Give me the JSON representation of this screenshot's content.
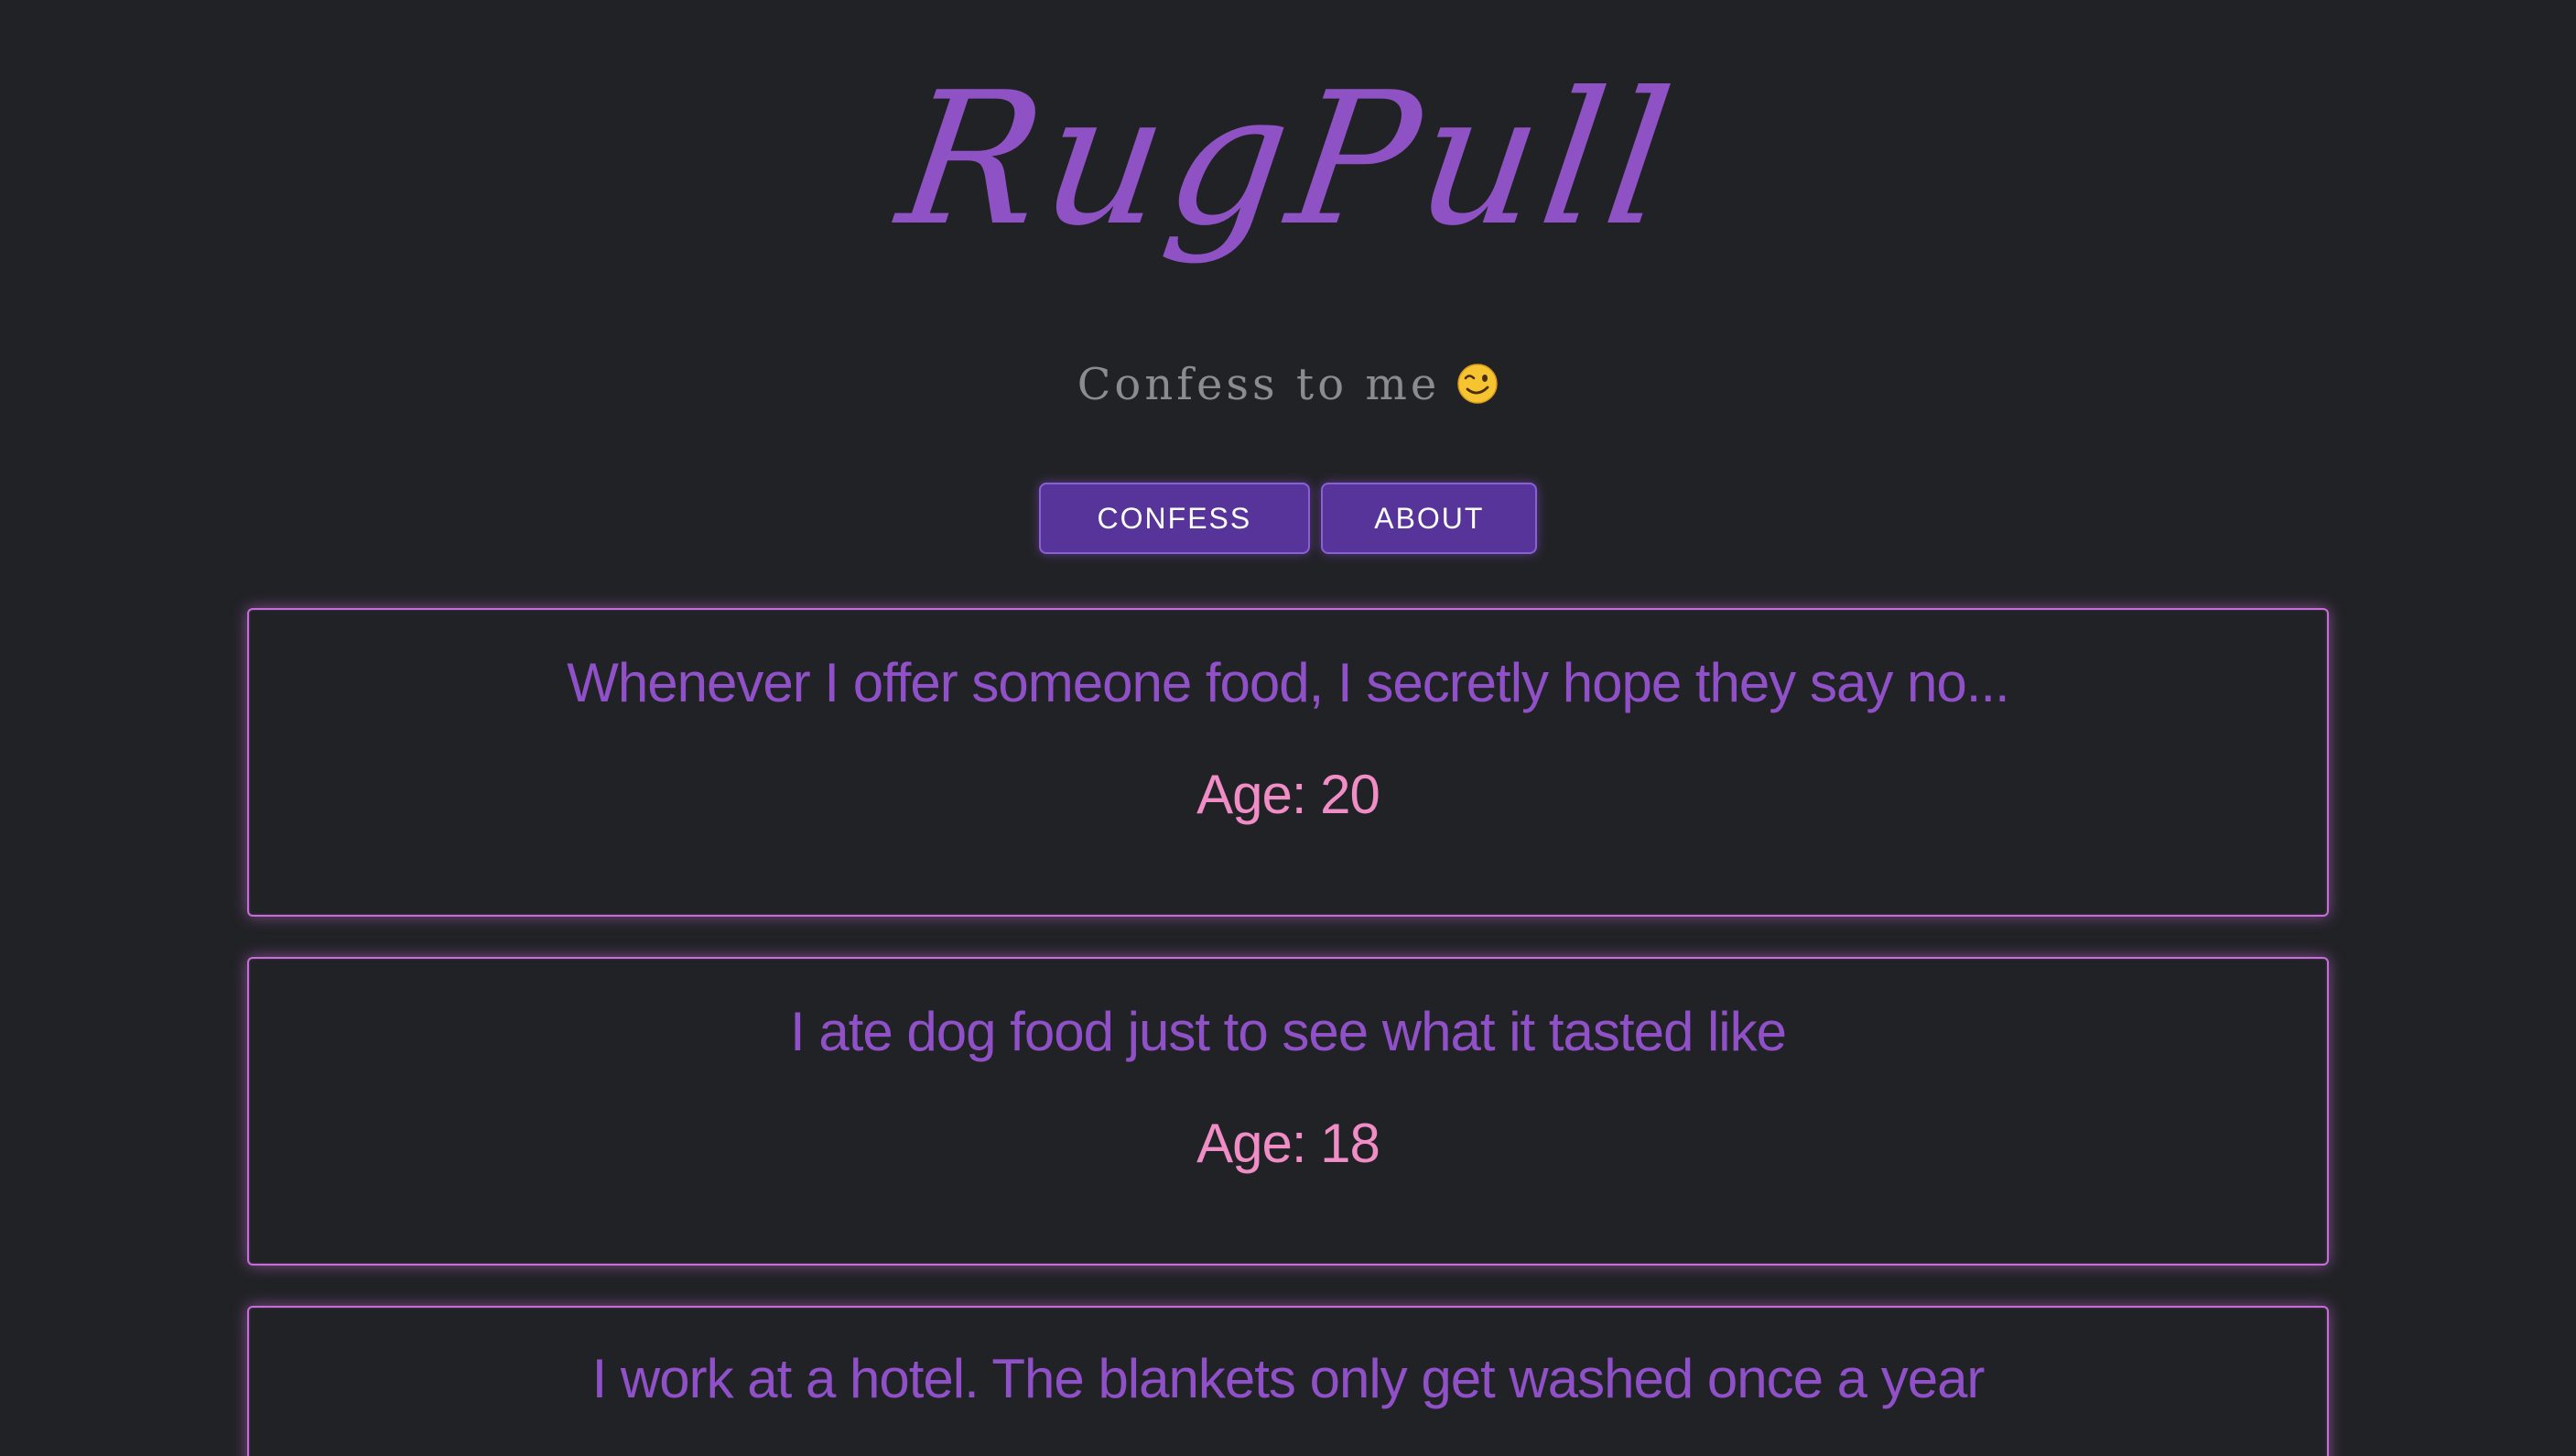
{
  "header": {
    "logo_text": "RugPull",
    "tagline": "Confess to me",
    "tagline_icon": "winking-face-icon"
  },
  "nav": {
    "confess_label": "CONFESS",
    "about_label": "ABOUT"
  },
  "colors": {
    "background": "#212226",
    "accent_purple": "#8f52c4",
    "button_fill": "#57349a",
    "card_border": "#c56fd6",
    "age_pink": "#f08cc6"
  },
  "confessions": [
    {
      "text": "Whenever I offer someone food, I secretly hope they say no...",
      "age": "Age: 20"
    },
    {
      "text": "I ate dog food just to see what it tasted like",
      "age": "Age: 18"
    },
    {
      "text": "I work at a hotel. The blankets only get washed once a year",
      "age": ""
    }
  ]
}
